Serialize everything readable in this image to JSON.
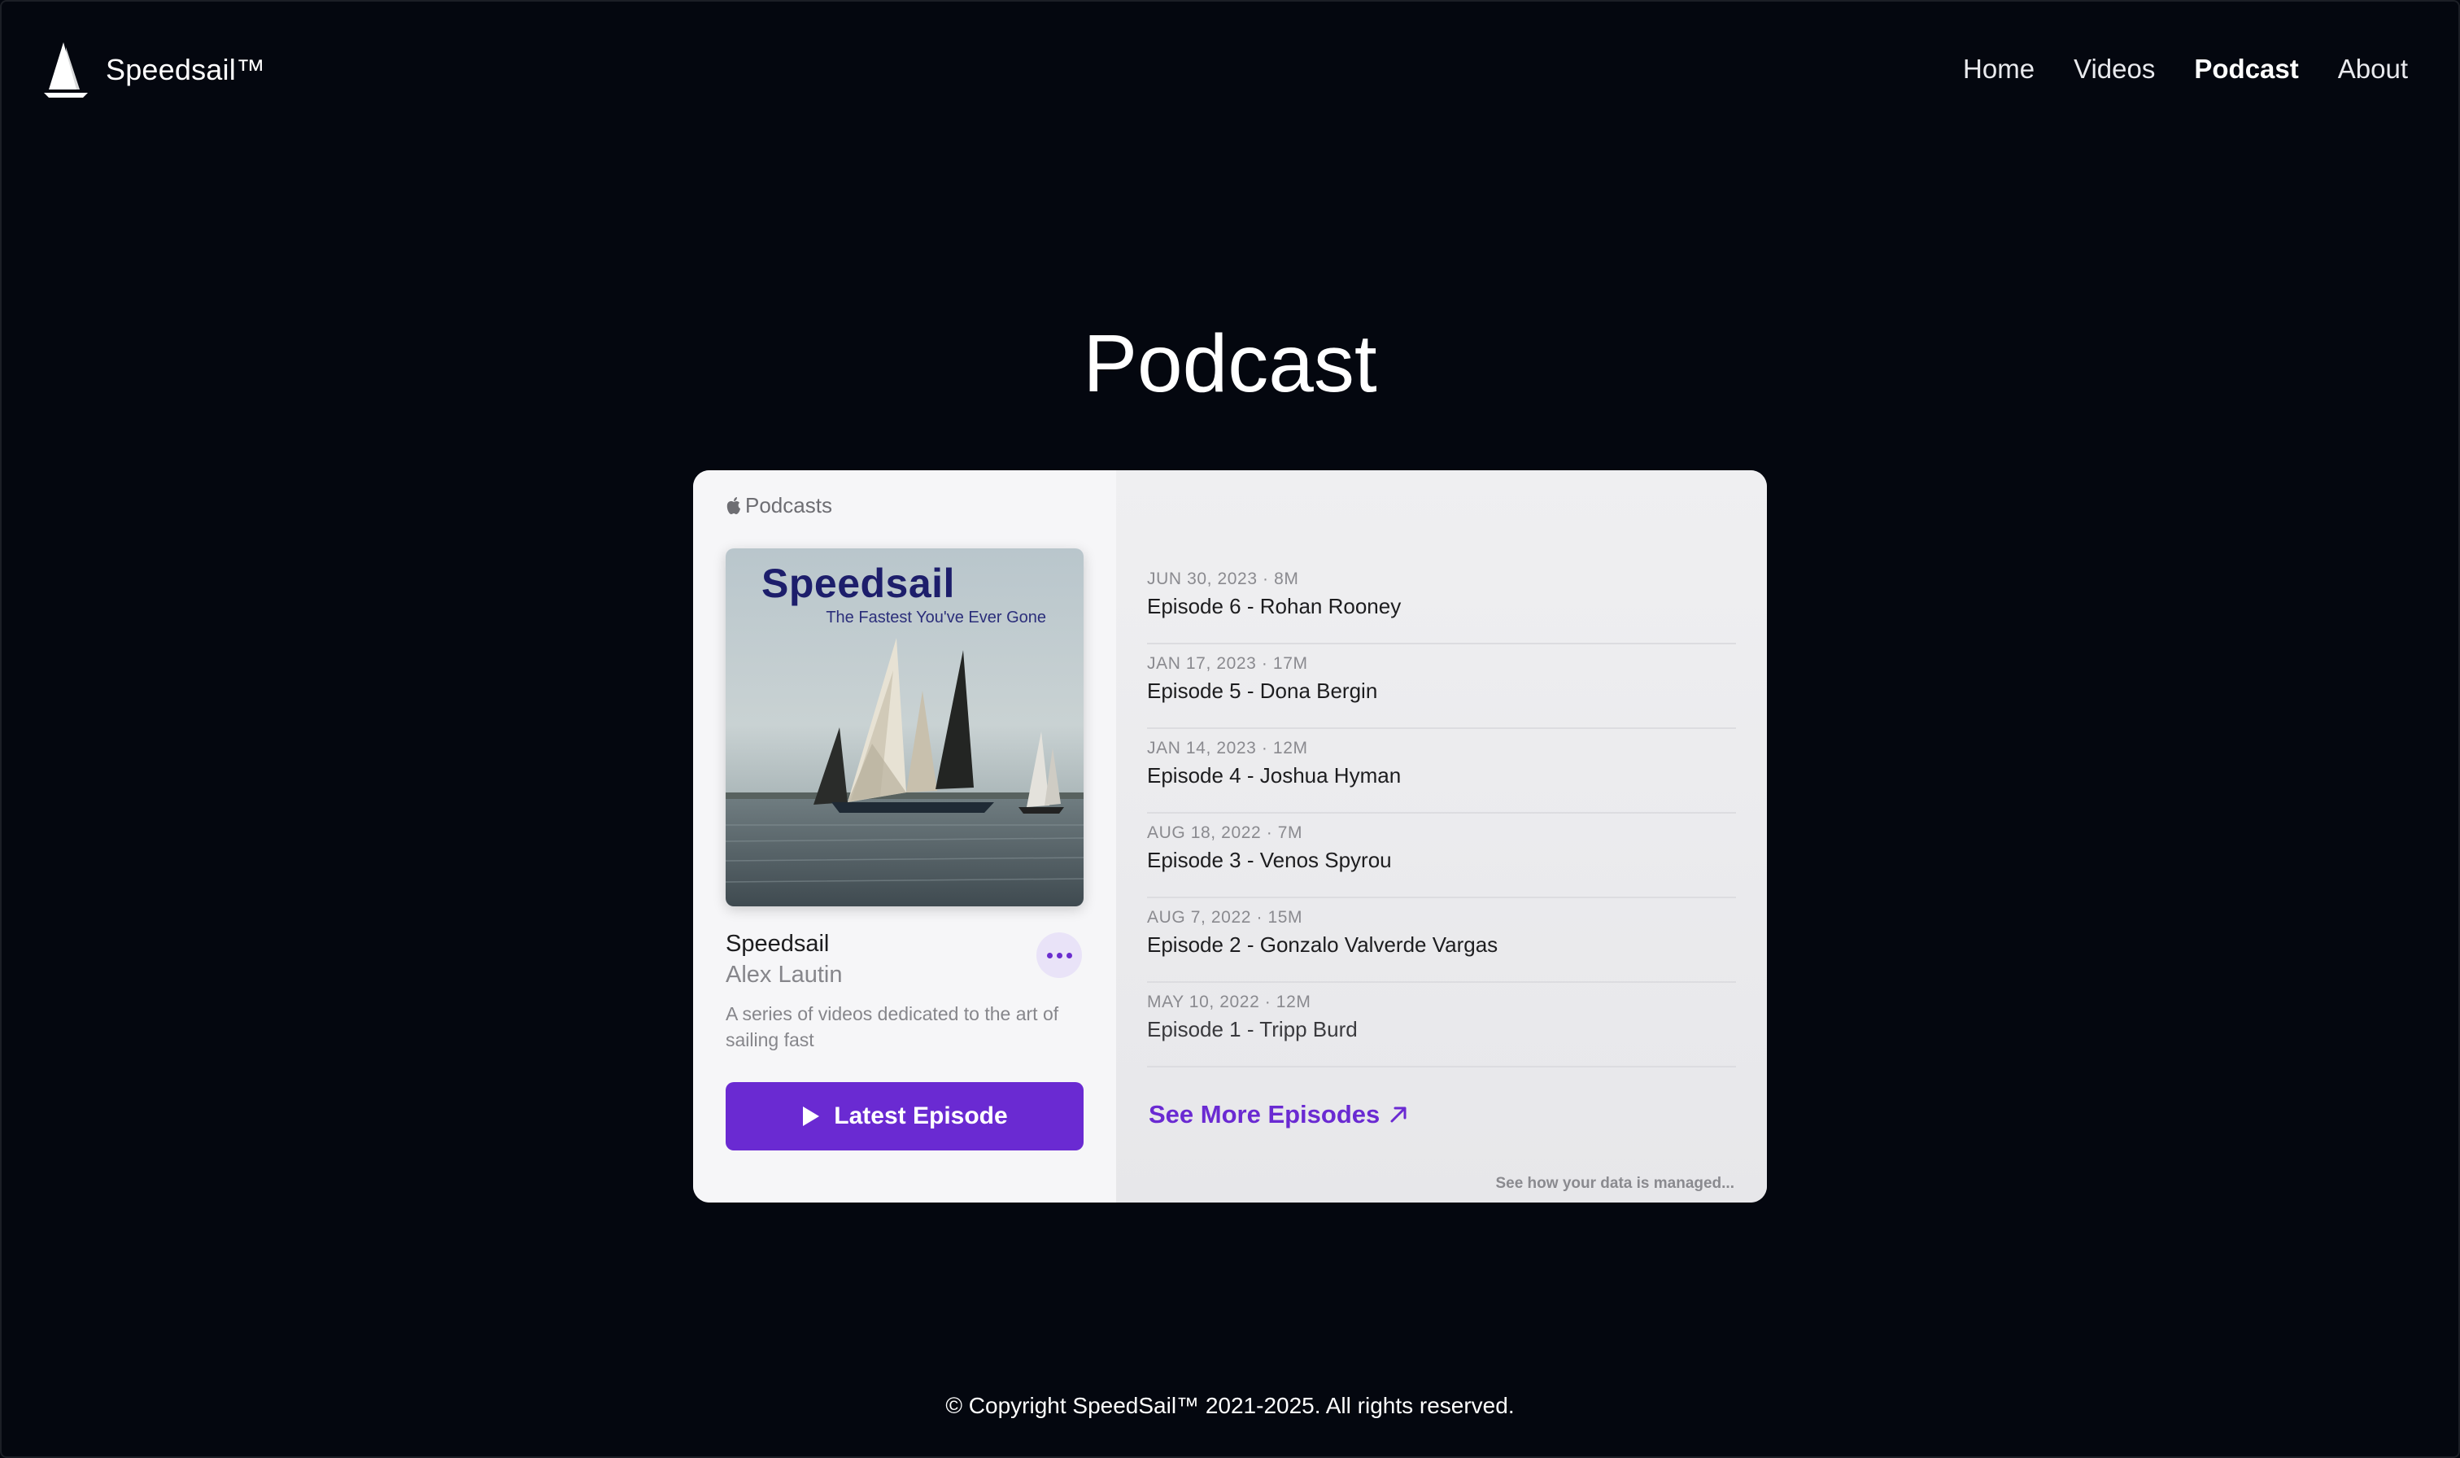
{
  "brand": {
    "name": "Speedsail™"
  },
  "nav": [
    {
      "label": "Home",
      "active": false
    },
    {
      "label": "Videos",
      "active": false
    },
    {
      "label": "Podcast",
      "active": true
    },
    {
      "label": "About",
      "active": false
    }
  ],
  "page": {
    "title": "Podcast"
  },
  "embed": {
    "provider_label": "Podcasts",
    "artwork": {
      "title": "Speedsail",
      "subtitle": "The Fastest You've Ever Gone"
    },
    "show": {
      "name": "Speedsail",
      "author": "Alex Lautin",
      "description": "A series of videos dedicated to the art of sailing fast"
    },
    "latest_label": "Latest Episode",
    "episodes": [
      {
        "meta": "JUN 30, 2023 · 8M",
        "title": "Episode 6 - Rohan Rooney"
      },
      {
        "meta": "JAN 17, 2023 · 17M",
        "title": "Episode 5 - Dona Bergin"
      },
      {
        "meta": "JAN 14, 2023 · 12M",
        "title": "Episode 4 - Joshua Hyman"
      },
      {
        "meta": "AUG 18, 2022 · 7M",
        "title": "Episode 3 - Venos Spyrou"
      },
      {
        "meta": "AUG 7, 2022 · 15M",
        "title": "Episode 2 - Gonzalo Valverde Vargas"
      },
      {
        "meta": "MAY 10, 2022 · 12M",
        "title": "Episode 1 - Tripp Burd"
      }
    ],
    "see_more_label": "See More Episodes",
    "data_notice": "See how your data is managed..."
  },
  "footer": {
    "text": "© Copyright SpeedSail™ 2021-2025. All rights reserved."
  },
  "colors": {
    "background": "#04070f",
    "accent": "#6a2ad2"
  }
}
